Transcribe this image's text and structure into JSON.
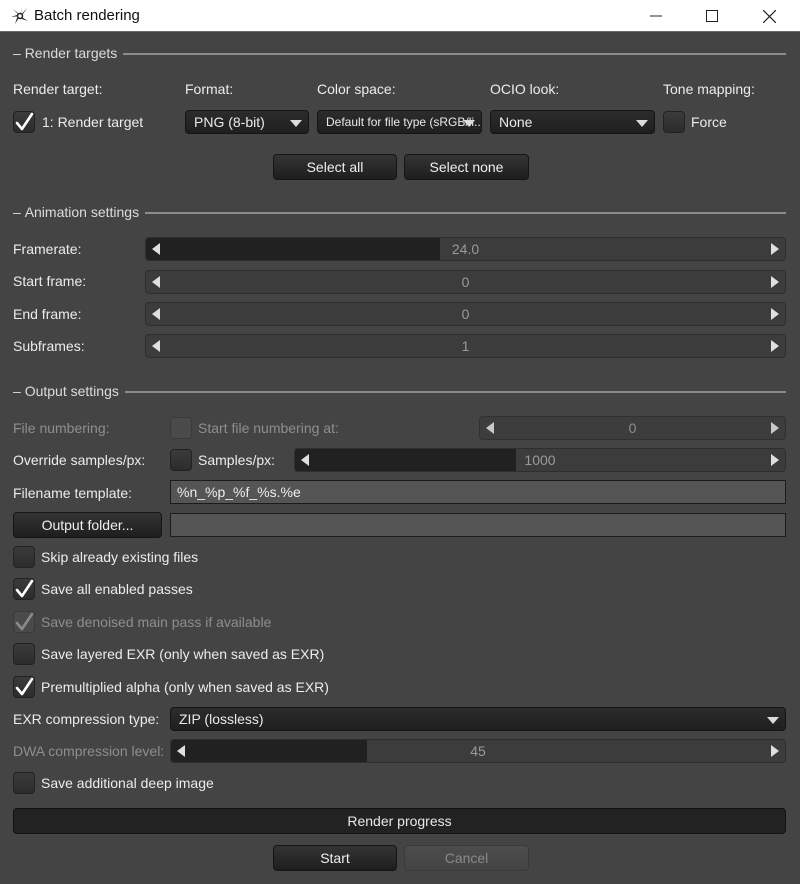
{
  "window": {
    "title": "Batch rendering",
    "icon": "octane-logo-icon",
    "controls": {
      "minimize": "minimize-icon",
      "maximize": "maximize-icon",
      "close": "close-icon"
    }
  },
  "render_targets": {
    "section_title": "Render targets",
    "headers": {
      "render_target": "Render target:",
      "format": "Format:",
      "color_space": "Color space:",
      "ocio_look": "OCIO look:",
      "tone_mapping": "Tone mapping:"
    },
    "rows": [
      {
        "enabled": true,
        "name": "1: Render target",
        "format": "PNG (8-bit)",
        "color_space": "Default for file type (sRGB/li...",
        "ocio_look": "None",
        "force_tone_mapping": false,
        "force_label": "Force"
      }
    ],
    "select_all": "Select all",
    "select_none": "Select none"
  },
  "animation": {
    "section_title": "Animation settings",
    "fields": [
      {
        "label": "Framerate:",
        "value": "24.0",
        "fill": 0.46
      },
      {
        "label": "Start frame:",
        "value": "0",
        "fill": 0
      },
      {
        "label": "End frame:",
        "value": "0",
        "fill": 0
      },
      {
        "label": "Subframes:",
        "value": "1",
        "fill": 0
      }
    ]
  },
  "output": {
    "section_title": "Output settings",
    "file_numbering": {
      "label": "File numbering:",
      "checked": false,
      "checkbox_label": "Start file numbering at:",
      "value": "0",
      "fill": 0
    },
    "override_samples": {
      "label": "Override samples/px:",
      "checked": false,
      "checkbox_label": "Samples/px:",
      "value": "1000",
      "fill": 0.45
    },
    "filename_template": {
      "label": "Filename template:",
      "value": "%n_%p_%f_%s.%e"
    },
    "output_folder": {
      "button": "Output folder...",
      "value": ""
    },
    "options": [
      {
        "label": "Skip already existing files",
        "checked": false,
        "disabled": false
      },
      {
        "label": "Save all enabled passes",
        "checked": true,
        "disabled": false
      },
      {
        "label": "Save denoised main pass if available",
        "checked": true,
        "disabled": true
      },
      {
        "label": "Save layered EXR (only when saved as EXR)",
        "checked": false,
        "disabled": false
      },
      {
        "label": "Premultiplied alpha (only when saved as EXR)",
        "checked": true,
        "disabled": false
      }
    ],
    "exr_compression": {
      "label": "EXR compression type:",
      "value": "ZIP (lossless)"
    },
    "dwa_level": {
      "label": "DWA compression level:",
      "value": "45",
      "fill": 0.32
    },
    "deep_image": {
      "label": "Save additional deep image",
      "checked": false
    }
  },
  "progress": {
    "label": "Render progress",
    "value": 0
  },
  "actions": {
    "start": "Start",
    "cancel": "Cancel"
  }
}
